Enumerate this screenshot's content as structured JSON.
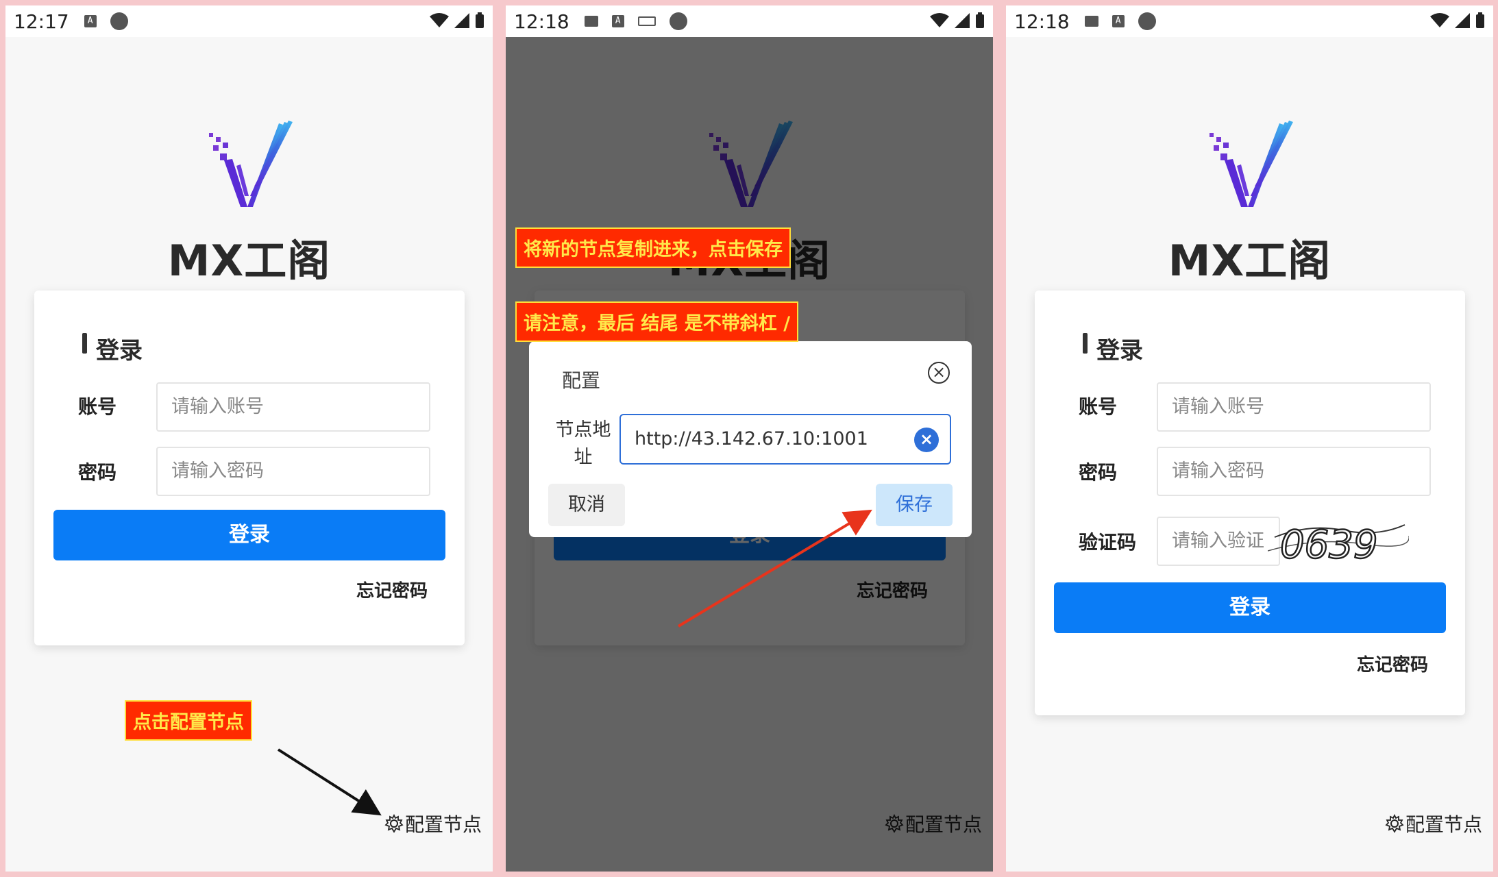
{
  "statusbar": [
    {
      "time": "12:17"
    },
    {
      "time": "12:18"
    },
    {
      "time": "12:18"
    }
  ],
  "app": {
    "brand": "MX工阁",
    "card_title": "登录",
    "account_label": "账号",
    "account_placeholder": "请输入账号",
    "password_label": "密码",
    "password_placeholder": "请输入密码",
    "captcha_label": "验证码",
    "captcha_placeholder": "请输入验证",
    "captcha_text": "0639",
    "login_button": "登录",
    "forgot_password": "忘记密码",
    "config_node": "配置节点"
  },
  "dialog": {
    "title": "配置",
    "node_label": "节点地址",
    "node_value": "http://43.142.67.10:1001",
    "cancel": "取消",
    "save": "保存"
  },
  "annotations": {
    "click_config": "点击配置节点",
    "paste_save": "将新的节点复制进来，点击保存",
    "note_slash": "请注意，最后 结尾 是不带斜杠 /"
  },
  "colors": {
    "primary": "#0a7cf6",
    "annotation_bg": "#ff2a00",
    "annotation_text": "#ffe94a"
  }
}
